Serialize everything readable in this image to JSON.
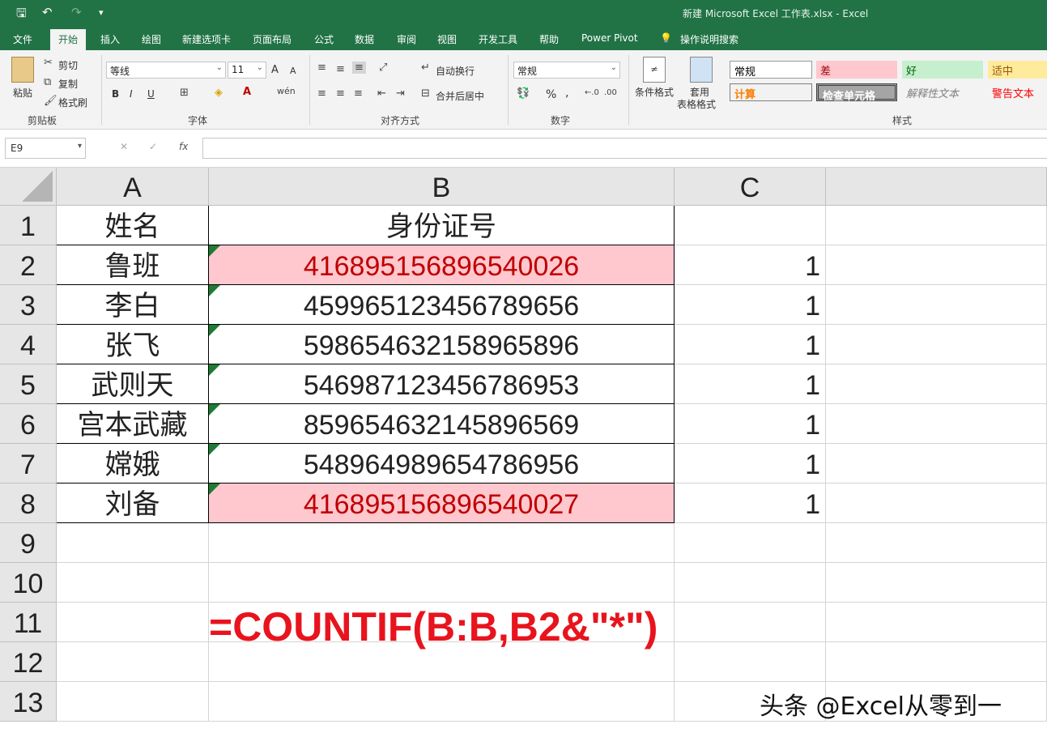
{
  "app": {
    "window_title": "新建 Microsoft Excel 工作表.xlsx  -  Excel"
  },
  "quick_access": {
    "save": "🖫",
    "undo": "↶",
    "redo": "↷",
    "customize": "▾"
  },
  "tabs": [
    "文件",
    "开始",
    "插入",
    "绘图",
    "新建选项卡",
    "页面布局",
    "公式",
    "数据",
    "审阅",
    "视图",
    "开发工具",
    "帮助",
    "Power Pivot",
    "操作说明搜索"
  ],
  "ribbon": {
    "clipboard": {
      "paste": "粘贴",
      "cut": "剪切",
      "copy": "复制",
      "format_painter": "格式刷",
      "label": "剪贴板"
    },
    "font": {
      "name": "等线",
      "size": "11",
      "bold": "B",
      "italic": "I",
      "underline": "U",
      "grow": "A",
      "shrink": "A",
      "label": "字体"
    },
    "alignment": {
      "wrap": "自动换行",
      "merge": "合并后居中",
      "label": "对齐方式"
    },
    "number": {
      "format": "常规",
      "percent": "%",
      "comma": ",",
      "label": "数字"
    },
    "styles": {
      "conditional": "条件格式",
      "table_line1": "套用",
      "table_line2": "表格格式",
      "normal": "常规",
      "bad": "差",
      "good": "好",
      "neutral": "适中",
      "calc": "计算",
      "check": "检查单元格",
      "explanatory": "解释性文本",
      "warning": "警告文本",
      "label": "样式"
    }
  },
  "formula_bar": {
    "name_box": "E9",
    "cancel": "✕",
    "enter": "✓",
    "fx": "fx",
    "content": ""
  },
  "grid": {
    "columns": [
      "A",
      "B",
      "C"
    ],
    "rows": [
      "1",
      "2",
      "3",
      "4",
      "5",
      "6",
      "7",
      "8",
      "9",
      "10",
      "11",
      "12",
      "13"
    ],
    "header": {
      "a": "姓名",
      "b": "身份证号"
    },
    "data": [
      {
        "name": "鲁班",
        "id": "416895156896540026",
        "count": "1",
        "highlight": true
      },
      {
        "name": "李白",
        "id": "459965123456789656",
        "count": "1",
        "highlight": false
      },
      {
        "name": "张飞",
        "id": "598654632158965896",
        "count": "1",
        "highlight": false
      },
      {
        "name": "武则天",
        "id": "546987123456786953",
        "count": "1",
        "highlight": false
      },
      {
        "name": "宫本武藏",
        "id": "859654632145896569",
        "count": "1",
        "highlight": false
      },
      {
        "name": "嫦娥",
        "id": "548964989654786956",
        "count": "1",
        "highlight": false
      },
      {
        "name": "刘备",
        "id": "416895156896540027",
        "count": "1",
        "highlight": true
      }
    ]
  },
  "overlay": {
    "formula": "=COUNTIF(B:B,B2&\"*\")",
    "watermark": "头条 @Excel从零到一"
  },
  "colors": {
    "excel_green": "#217346",
    "highlight_fill": "#ffc7ce",
    "highlight_text": "#c00000",
    "formula_red": "#e8141d"
  }
}
